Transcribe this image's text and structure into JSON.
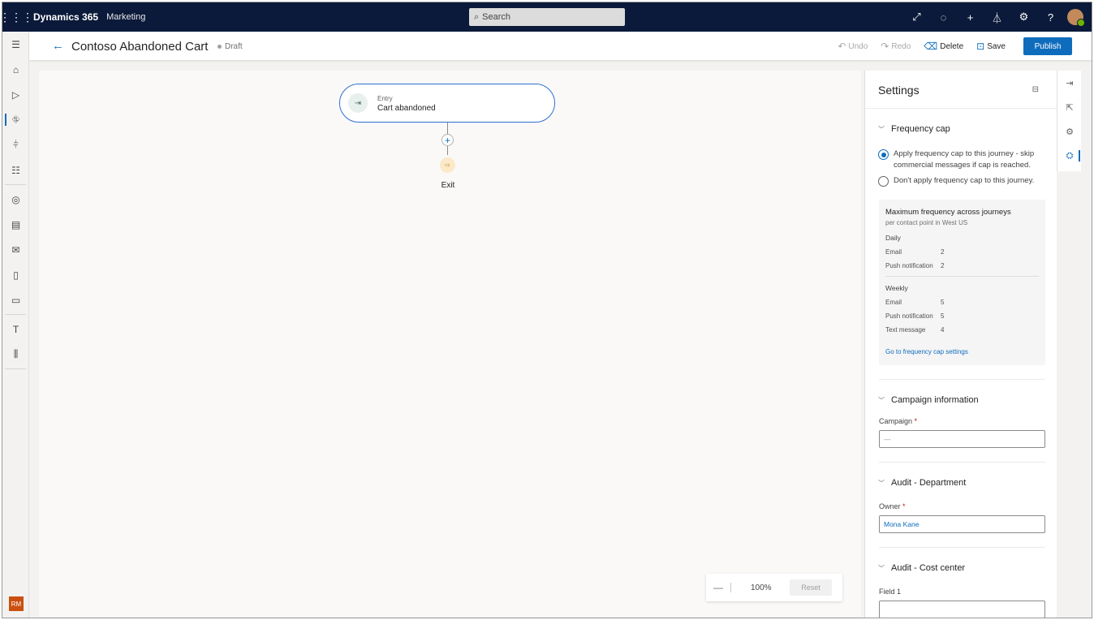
{
  "topbar": {
    "app_name": "Dynamics 365",
    "module": "Marketing",
    "search_placeholder": "Search",
    "icons": [
      "launch-icon",
      "lightbulb-icon",
      "plus-icon",
      "filter-icon",
      "gear-icon",
      "help-icon"
    ]
  },
  "leftnav": {
    "items": [
      "menu-icon",
      "home-icon",
      "play-icon",
      "journey-icon",
      "segments-icon",
      "filter-list-icon",
      "globe-icon",
      "table-icon",
      "email-icon",
      "phone-icon",
      "chat-icon",
      "text-icon",
      "list-icon"
    ],
    "active_index": 3,
    "user_initials": "RM"
  },
  "command_bar": {
    "title": "Contoso Abandoned Cart",
    "status": "Draft",
    "undo": "Undo",
    "redo": "Redo",
    "delete": "Delete",
    "save": "Save",
    "publish": "Publish"
  },
  "canvas": {
    "entry_label": "Entry",
    "entry_name": "Cart abandoned",
    "exit_label": "Exit",
    "zoom_level": "100%",
    "reset_label": "Reset"
  },
  "settings": {
    "title": "Settings",
    "frequency_cap": {
      "heading": "Frequency cap",
      "option_apply": "Apply frequency cap to this journey - skip commercial messages if cap is reached.",
      "option_dont_apply": "Don't apply frequency cap to this journey.",
      "selected": "apply",
      "box_title": "Maximum frequency across journeys",
      "box_subtitle": "per contact point in West US",
      "daily_label": "Daily",
      "daily": [
        {
          "channel": "Email",
          "value": "2"
        },
        {
          "channel": "Push notification",
          "value": "2"
        }
      ],
      "weekly_label": "Weekly",
      "weekly": [
        {
          "channel": "Email",
          "value": "5"
        },
        {
          "channel": "Push notification",
          "value": "5"
        },
        {
          "channel": "Text message",
          "value": "4"
        }
      ],
      "link": "Go to frequency cap settings"
    },
    "campaign": {
      "heading": "Campaign information",
      "field_label": "Campaign",
      "value": "---"
    },
    "audit_department": {
      "heading": "Audit - Department",
      "field_label": "Owner",
      "value": "Mona Kane"
    },
    "audit_cost_center": {
      "heading": "Audit - Cost center",
      "field_label": "Field 1",
      "value": ""
    }
  },
  "right_rail": {
    "icons": [
      "exit-panel-icon",
      "share-icon",
      "settings-cog-icon",
      "journey-settings-icon"
    ],
    "active_index": 3
  }
}
